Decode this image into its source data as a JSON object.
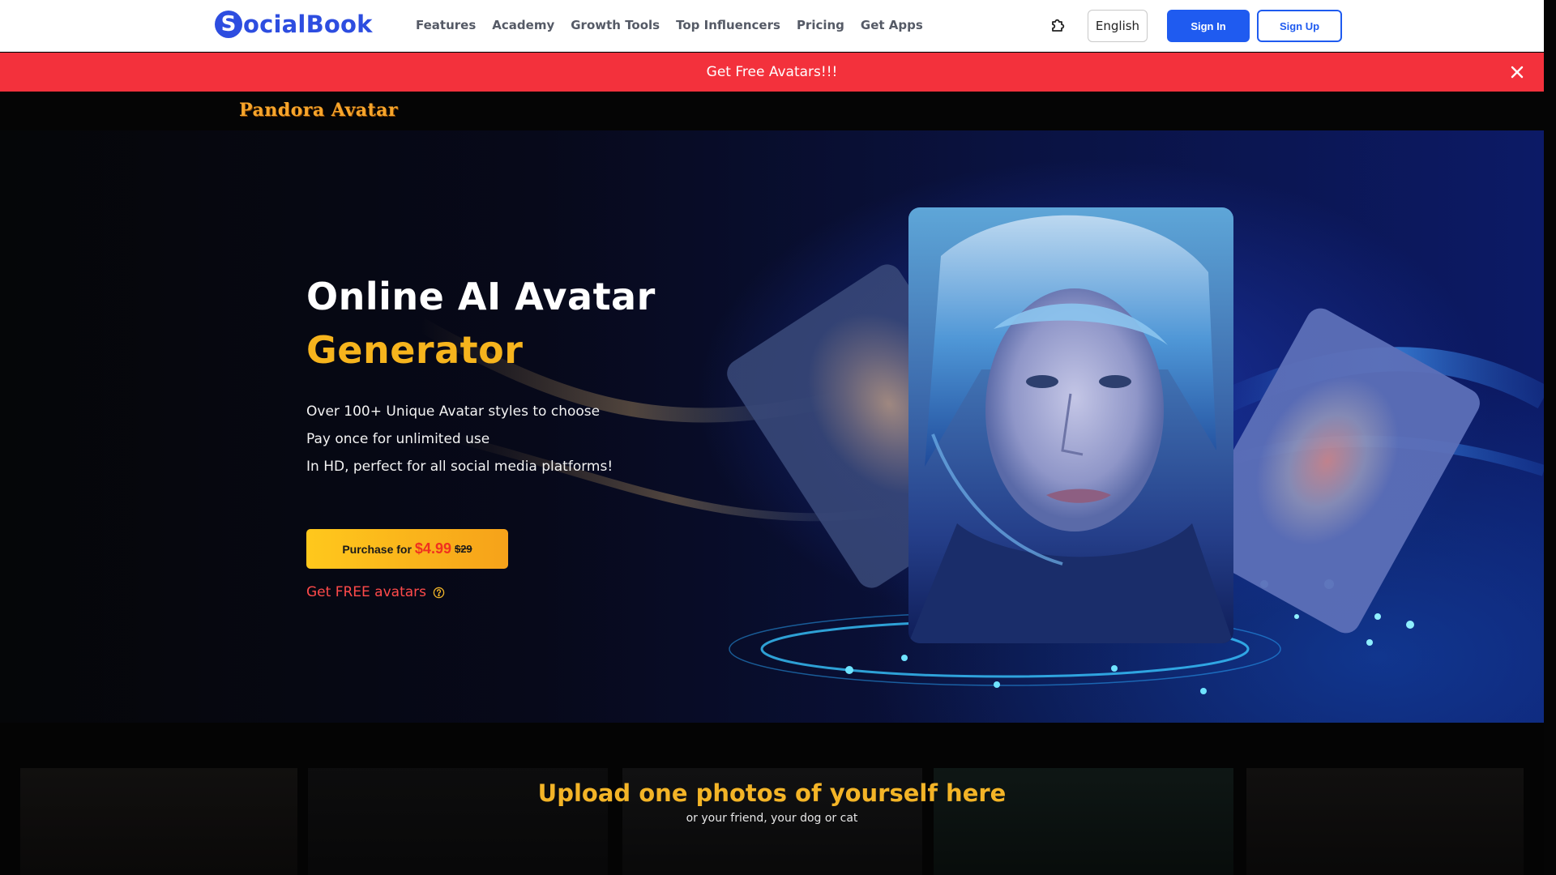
{
  "header": {
    "logo_text": "ocialBook",
    "logo_mark": "S",
    "nav": [
      "Features",
      "Academy",
      "Growth Tools",
      "Top Influencers",
      "Pricing",
      "Get Apps"
    ],
    "extension_icon": "puzzle-icon",
    "language": "English",
    "sign_in": "Sign In",
    "sign_up": "Sign Up"
  },
  "banner": {
    "text": "Get Free Avatars!!!",
    "close_icon": "close-icon",
    "color": "#f3313c"
  },
  "product_name": "Pandora Avatar",
  "hero": {
    "title_line1": "Online AI Avatar",
    "title_line2": "Generator",
    "features": [
      "Over 100+ Unique Avatar styles to choose",
      "Pay once for unlimited use",
      "In HD, perfect for all social media platforms!"
    ],
    "purchase": {
      "label": "Purchase for",
      "price": "$4.99",
      "original_price": "$29"
    },
    "free_link": "Get FREE avatars",
    "help_icon": "question-circle-icon",
    "accent_color": "#f6b41d"
  },
  "upload": {
    "title": "Upload one photos of yourself here",
    "subtitle": "or your friend, your dog or cat"
  }
}
